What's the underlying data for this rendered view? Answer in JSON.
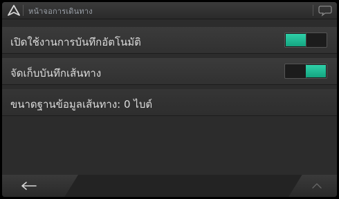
{
  "header": {
    "title": "หน้าจอการเดินทาง",
    "nav_icon": "navigation-arrow-icon",
    "chat_icon": "speech-bubble-icon"
  },
  "settings": [
    {
      "label": "เปิดใช้งานการบันทึกอัตโนมัติ",
      "toggle": "on"
    },
    {
      "label": "จัดเก็บบันทึกเส้นทาง",
      "toggle": "on"
    }
  ],
  "info": {
    "label": "ขนาดฐานข้อมูลเส้นทาง: 0 ไบต์"
  },
  "footer": {
    "back_icon": "back-arrow-icon",
    "up_icon": "chevron-up-icon"
  },
  "colors": {
    "accent": "#1fbf95",
    "background": "#2c2c2c"
  }
}
